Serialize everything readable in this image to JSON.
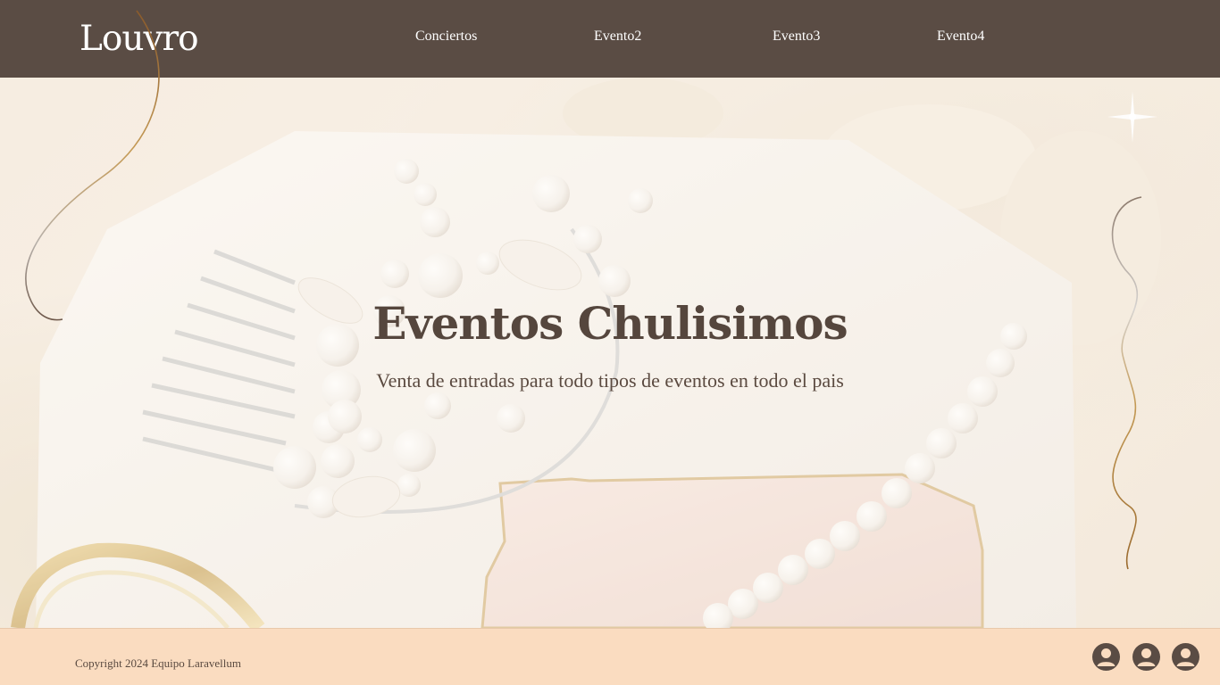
{
  "header": {
    "logo": "Louvro",
    "nav": [
      {
        "label": "Conciertos"
      },
      {
        "label": "Evento2"
      },
      {
        "label": "Evento3"
      },
      {
        "label": "Evento4"
      }
    ]
  },
  "hero": {
    "title": "Eventos Chulisimos",
    "subtitle": "Venta de entradas para todo tipos de eventos en todo el pais"
  },
  "footer": {
    "copyright": "Copyright 2024 Equipo Laravellum",
    "social_icons": [
      "user-icon",
      "user-icon",
      "user-icon"
    ]
  },
  "colors": {
    "header_bg": "#5a4c44",
    "footer_bg": "#fadcc0",
    "title_text": "#55463d",
    "accent_gold": "#b8924e"
  }
}
